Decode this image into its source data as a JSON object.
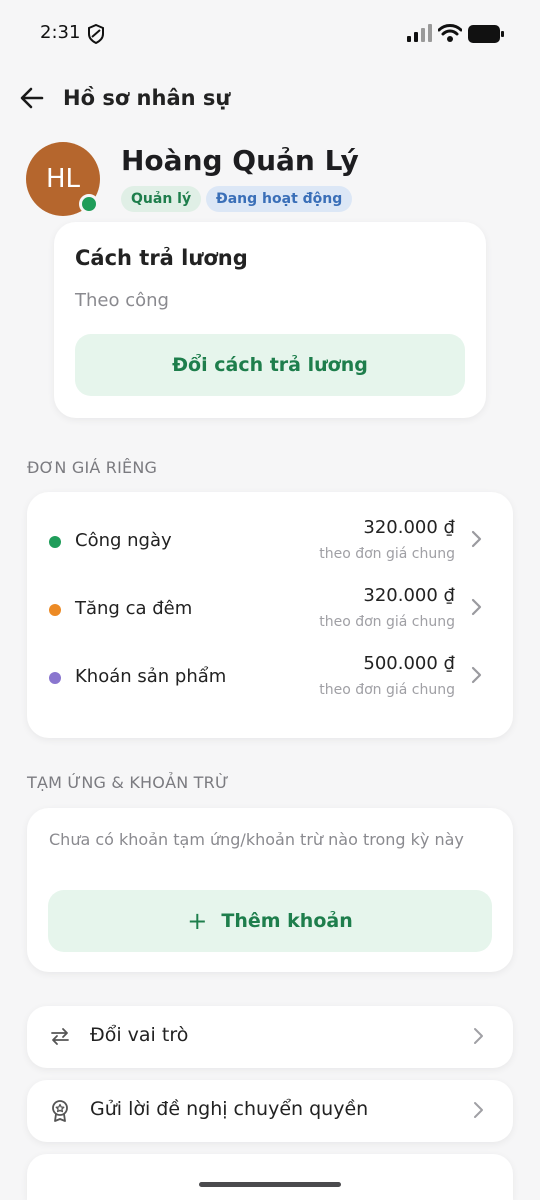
{
  "status_bar": {
    "time": "2:31",
    "icons": [
      "shield-icon",
      "signal-icon",
      "wifi-icon",
      "battery-icon"
    ]
  },
  "header": {
    "back_icon": "arrow-left-icon",
    "title": "Hồ sơ nhân sự"
  },
  "profile": {
    "initials": "HL",
    "name": "Hoàng Quản Lý",
    "role_badge": "Quản lý",
    "status_badge": "Đang hoạt động",
    "avatar_color": "#b5662d",
    "online_color": "#1f9d5a"
  },
  "pay_method": {
    "title": "Cách trả lương",
    "value": "Theo công",
    "button_label": "Đổi cách trả lương"
  },
  "rates": {
    "section_label": "ĐƠN GIÁ RIÊNG",
    "items": [
      {
        "label": "Công ngày",
        "amount": "320.000 ₫",
        "note": "theo đơn giá chung",
        "color": "#1f9d5a"
      },
      {
        "label": "Tăng ca đêm",
        "amount": "320.000 ₫",
        "note": "theo đơn giá chung",
        "color": "#ec8a25"
      },
      {
        "label": "Khoán sản phẩm",
        "amount": "500.000 ₫",
        "note": "theo đơn giá chung",
        "color": "#8a76cf"
      }
    ]
  },
  "advances": {
    "section_label": "TẠM ỨNG & KHOẢN TRỪ",
    "empty_text": "Chưa có khoản tạm ứng/khoản trừ nào trong kỳ này",
    "add_button_label": "Thêm khoản"
  },
  "actions": [
    {
      "label": "Đổi vai trò",
      "icon": "swap-icon"
    },
    {
      "label": "Gửi lời đề nghị chuyển quyền",
      "icon": "award-icon"
    }
  ],
  "colors": {
    "accent": "#1e7e4c",
    "accent_bg": "#e6f5ec",
    "info": "#3a6fb8"
  }
}
